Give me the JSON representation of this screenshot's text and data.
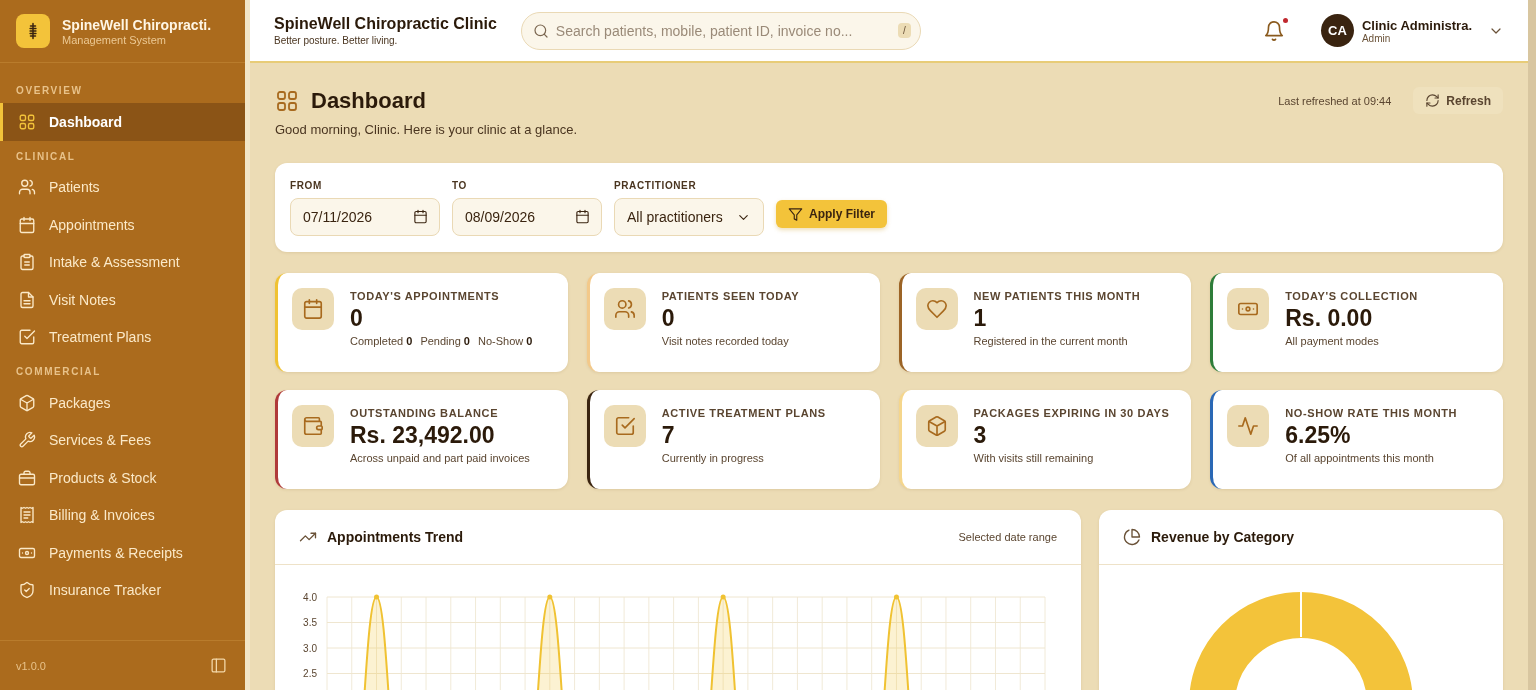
{
  "sidebar": {
    "brand": {
      "title": "SpineWell Chiropracti.",
      "subtitle": "Management System"
    },
    "sections": [
      {
        "label": "OVERVIEW",
        "items": [
          {
            "label": "Dashboard",
            "selected": true
          }
        ]
      },
      {
        "label": "CLINICAL",
        "items": [
          {
            "label": "Patients",
            "selected": false
          },
          {
            "label": "Appointments",
            "selected": false
          },
          {
            "label": "Intake & Assessment",
            "selected": false
          },
          {
            "label": "Visit Notes",
            "selected": false
          },
          {
            "label": "Treatment Plans",
            "selected": false
          }
        ]
      },
      {
        "label": "COMMERCIAL",
        "items": [
          {
            "label": "Packages",
            "selected": false
          },
          {
            "label": "Services & Fees",
            "selected": false
          },
          {
            "label": "Products & Stock",
            "selected": false
          },
          {
            "label": "Billing & Invoices",
            "selected": false
          },
          {
            "label": "Payments & Receipts",
            "selected": false
          },
          {
            "label": "Insurance Tracker",
            "selected": false
          }
        ]
      }
    ],
    "version": "v1.0.0"
  },
  "header": {
    "title": "SpineWell Chiropractic Clinic",
    "tagline": "Better posture. Better living.",
    "search": {
      "placeholder": "Search patients, mobile, patient ID, invoice no...",
      "shortcut": "/"
    },
    "notifications": {
      "unread": true
    },
    "user": {
      "initials": "CA",
      "name": "Clinic Administra.",
      "role": "Admin"
    }
  },
  "page": {
    "title": "Dashboard",
    "subtitle": "Good morning, Clinic. Here is your clinic at a glance.",
    "last_refreshed": "Last refreshed at 09:44",
    "refresh_button": "Refresh"
  },
  "filters": {
    "from": {
      "label": "FROM",
      "value": "07/11/2026"
    },
    "to": {
      "label": "TO",
      "value": "08/09/2026"
    },
    "practitioner": {
      "label": "PRACTITIONER",
      "value": "All practitioners"
    },
    "apply_button": "Apply Filter"
  },
  "stats": [
    {
      "title": "TODAY'S APPOINTMENTS",
      "value": "0",
      "breakdown": [
        "Completed **0**",
        "Pending **0**",
        "No-Show **0**"
      ],
      "color": "#f0c232"
    },
    {
      "title": "PATIENTS SEEN TODAY",
      "value": "0",
      "note": "Visit notes recorded today",
      "color": "#f3c98a"
    },
    {
      "title": "NEW PATIENTS THIS MONTH",
      "value": "1",
      "note": "Registered in the current month",
      "color": "#9c6426"
    },
    {
      "title": "TODAY'S COLLECTION",
      "value": "Rs. 0.00",
      "note": "All payment modes",
      "color": "#2e7d3a"
    },
    {
      "title": "OUTSTANDING BALANCE",
      "value": "Rs. 23,492.00",
      "note": "Across unpaid and part paid invoices",
      "color": "#b03a3a"
    },
    {
      "title": "ACTIVE TREATMENT PLANS",
      "value": "7",
      "note": "Currently in progress",
      "color": "#3a2410"
    },
    {
      "title": "PACKAGES EXPIRING IN 30 DAYS",
      "value": "3",
      "note": "With visits still remaining",
      "color": "#f5d68c"
    },
    {
      "title": "NO-SHOW RATE THIS MONTH",
      "value": "6.25%",
      "note": "Of all appointments this month",
      "color": "#2a68b5"
    }
  ],
  "trend": {
    "title": "Appointments Trend",
    "range_label": "Selected date range",
    "chart_data": {
      "type": "area",
      "grid": true,
      "ylim": [
        0,
        4
      ],
      "yticks": [
        {
          "value": 2.5,
          "label": "2.5"
        },
        {
          "value": 3,
          "label": "3.0"
        },
        {
          "value": 3.5,
          "label": "3.5"
        },
        {
          "value": 4,
          "label": "4.0"
        }
      ],
      "series": [
        {
          "color": "#f0c232",
          "values": [
            0,
            0,
            4,
            0,
            0,
            0,
            0,
            0,
            0,
            4,
            0,
            0,
            0,
            0,
            0,
            0,
            4,
            0,
            0,
            0,
            0,
            0,
            0,
            4,
            0,
            0,
            0,
            0,
            0,
            0
          ]
        }
      ]
    }
  },
  "revenue": {
    "title": "Revenue by Category"
  }
}
